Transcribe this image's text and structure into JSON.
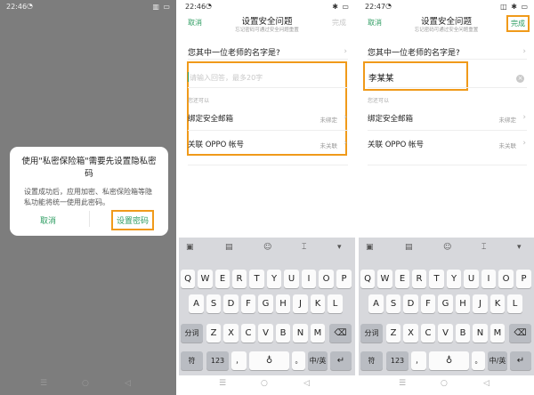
{
  "panel1": {
    "status_time": "22:46",
    "dialog": {
      "title": "使用\"私密保险箱\"需要先设置隐私密码",
      "body": "设置成功后，应用加密、私密保险箱等隐私功能将统一使用此密码。",
      "cancel": "取消",
      "confirm": "设置密码"
    }
  },
  "panel2": {
    "status_time": "22:46",
    "header": {
      "cancel": "取消",
      "title": "设置安全问题",
      "subtitle": "忘记密码可通过安全问题重置",
      "done": "完成"
    },
    "question": "您其中一位老师的名字是?",
    "answer_placeholder": "请输入回答，最多20字",
    "section_label": "您还可以",
    "bind_email": "绑定安全邮箱",
    "bind_email_status": "未绑定",
    "link_account": "关联 OPPO 帐号",
    "link_account_status": "未关联"
  },
  "panel3": {
    "status_time": "22:47",
    "header": {
      "cancel": "取消",
      "title": "设置安全问题",
      "subtitle": "忘记密码可通过安全问题重置",
      "done": "完成"
    },
    "question": "您其中一位老师的名字是?",
    "answer_value": "李某某",
    "section_label": "您还可以",
    "bind_email": "绑定安全邮箱",
    "bind_email_status": "未绑定",
    "link_account": "关联 OPPO 帐号",
    "link_account_status": "未关联"
  },
  "keyboard": {
    "row1": [
      "Q",
      "W",
      "E",
      "R",
      "T",
      "Y",
      "U",
      "I",
      "O",
      "P"
    ],
    "row2": [
      "A",
      "S",
      "D",
      "F",
      "G",
      "H",
      "J",
      "K",
      "L"
    ],
    "row3": [
      "Z",
      "X",
      "C",
      "V",
      "B",
      "N",
      "M"
    ],
    "fenci": "分词",
    "fu": "符",
    "num": "123",
    "comma": "，",
    "period": "。",
    "lang": "中/英"
  },
  "colors": {
    "accent": "#2e9d62",
    "highlight": "#f09a1a",
    "keyboard_bg": "#d7d8dc"
  },
  "icons": [
    "signal-icon",
    "wifi-icon",
    "battery-icon",
    "vibrate-icon",
    "chevron-right-icon",
    "clear-icon",
    "toolbox-icon",
    "clipboard-icon",
    "emoji-icon",
    "cursor-icon",
    "keyboard-hide-icon",
    "backspace-icon",
    "enter-icon",
    "microphone-icon",
    "nav-menu-icon",
    "nav-home-icon",
    "nav-back-icon"
  ]
}
